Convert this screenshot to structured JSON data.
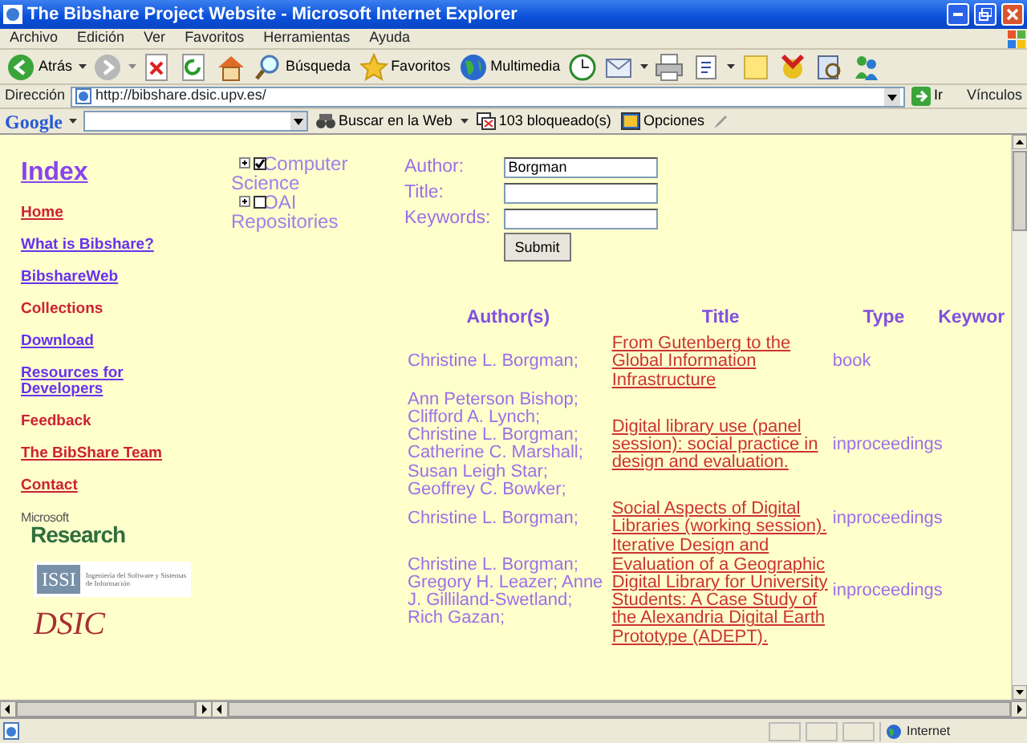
{
  "window": {
    "title": "The Bibshare Project Website - Microsoft Internet Explorer"
  },
  "menu": [
    "Archivo",
    "Edición",
    "Ver",
    "Favoritos",
    "Herramientas",
    "Ayuda"
  ],
  "toolbar": {
    "back": "Atrás",
    "search": "Búsqueda",
    "favorites": "Favoritos",
    "media": "Multimedia"
  },
  "address_bar": {
    "label": "Dirección",
    "url": "http://bibshare.dsic.upv.es/",
    "go": "Ir",
    "links": "Vínculos"
  },
  "google_bar": {
    "logo": "Google",
    "search_button": "Buscar en la Web",
    "blocked": "103 bloqueado(s)",
    "options": "Opciones"
  },
  "nav": {
    "title": "Index",
    "items": [
      {
        "label": "Home",
        "color": "#cc2233",
        "underlined": true
      },
      {
        "label": "What is Bibshare?",
        "color": "#6633ee",
        "underlined": true
      },
      {
        "label": "BibshareWeb",
        "color": "#6633ee",
        "underlined": true
      },
      {
        "label": "Collections",
        "color": "#cc2233",
        "underlined": false
      },
      {
        "label": "Download",
        "color": "#6633ee",
        "underlined": true
      },
      {
        "label": "Resources for Developers",
        "color": "#6633ee",
        "underlined": true
      },
      {
        "label": "Feedback",
        "color": "#cc2233",
        "underlined": false
      },
      {
        "label": "The BibShare Team",
        "color": "#cc2233",
        "underlined": true
      },
      {
        "label": "Contact",
        "color": "#cc2233",
        "underlined": true
      }
    ]
  },
  "logos": {
    "microsoft": "Microsoft",
    "research": "Research",
    "issi": "ISSI",
    "issi_text": "Ingeniería del Software y Sistemas de Información",
    "dsic": "DSIC"
  },
  "tree": [
    {
      "label": "Computer Science",
      "checked": true
    },
    {
      "label": "OAI Repositories",
      "checked": false
    }
  ],
  "form": {
    "fields": [
      {
        "label": "Author:",
        "value": "Borgman"
      },
      {
        "label": "Title:"
      },
      {
        "label": "Keywords:"
      }
    ],
    "submit": "Submit"
  },
  "table": {
    "columns": [
      "Author(s)",
      "Title",
      "Type",
      "Keywor"
    ],
    "rows": [
      {
        "authors": "Christine L. Borgman;",
        "title": "From Gutenberg to the Global Information Infrastructure",
        "type": "book"
      },
      {
        "authors": "Ann Peterson Bishop; Clifford A. Lynch; Christine L. Borgman; Catherine C. Marshall; Susan Leigh Star; Geoffrey C. Bowker;",
        "title": "Digital library use (panel session): social practice in design and evaluation.",
        "type": "inproceedings"
      },
      {
        "authors": "Christine L. Borgman;",
        "title": "Social Aspects of Digital Libraries (working session).",
        "type": "inproceedings"
      },
      {
        "authors": "Christine L. Borgman; Gregory H. Leazer; Anne J. Gilliland-Swetland; Rich Gazan;",
        "title": "Iterative Design and Evaluation of a Geographic Digital Library for University Students: A Case Study of the Alexandria Digital Earth Prototype (ADEPT).",
        "type": "inproceedings"
      }
    ]
  },
  "status_bar": {
    "zone": "Internet"
  }
}
